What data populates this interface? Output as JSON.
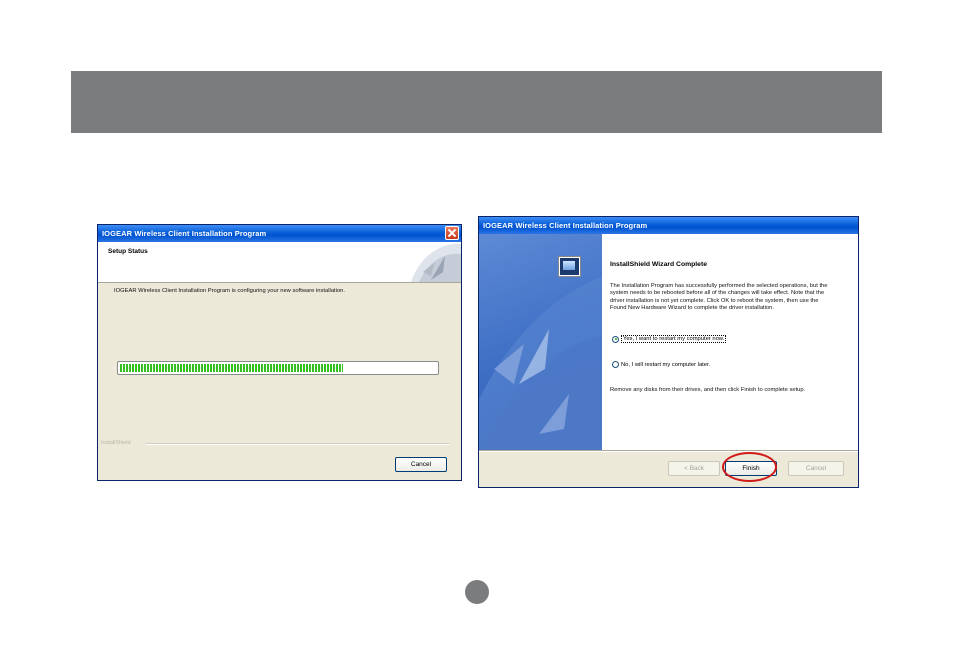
{
  "setup_dialog": {
    "title": "IOGEAR Wireless Client Installation Program",
    "header": "Setup Status",
    "message": "IOGEAR Wireless Client Installation Program is configuring your new software installation.",
    "progress_fraction": 0.71,
    "brand": "InstallShield",
    "cancel_label": "Cancel"
  },
  "complete_dialog": {
    "title": "IOGEAR Wireless Client Installation Program",
    "heading": "InstallShield Wizard Complete",
    "paragraph": "The Installation Program has successfully performed the selected operations, but the system needs to be rebooted before all of the changes will take effect. Note that the driver installation is not yet complete. Click OK to reboot the system, then use the Found New Hardware Wizard to complete the driver installation.",
    "option_restart_now": "Yes, I want to restart my computer now.",
    "option_restart_later": "No, I will restart my computer later.",
    "closing_text": "Remove any disks from their drives, and then click Finish to complete setup.",
    "back_label": "< Back",
    "finish_label": "Finish",
    "cancel_label": "Cancel"
  },
  "colors": {
    "banner": "#7b7c7e",
    "highlight": "#d01a1a"
  },
  "page_number": ""
}
